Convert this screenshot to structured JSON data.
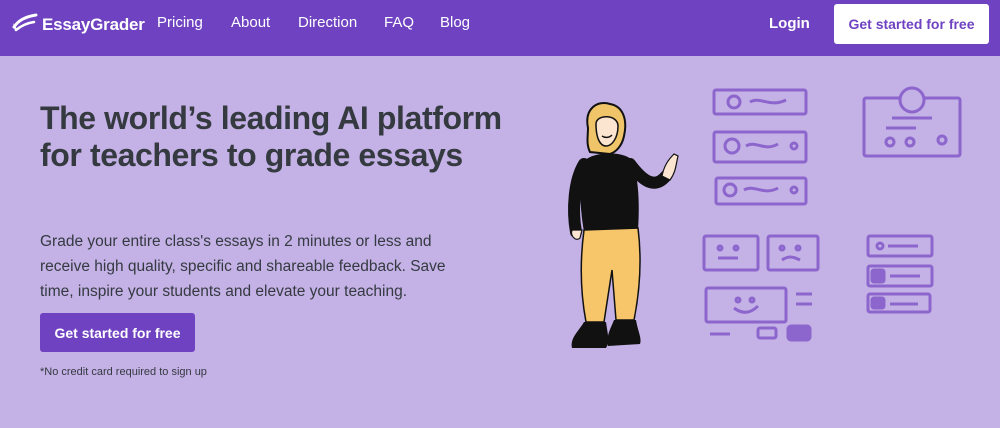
{
  "nav": {
    "brand": "EssayGrader",
    "links": [
      "Pricing",
      "About",
      "Direction",
      "FAQ",
      "Blog"
    ],
    "login": "Login",
    "cta": "Get started for free"
  },
  "hero": {
    "headline": "The world’s leading AI platform for teachers to grade essays",
    "subtext": "Grade your entire class's essays in 2 minutes or less and receive high quality, specific and shareable feedback. Save time, inspire your students and elevate your teaching.",
    "cta": "Get started for free",
    "note": "*No credit card required to sign up"
  },
  "colors": {
    "nav_bg": "#6f42c1",
    "page_bg": "#c4b1e6",
    "accent": "#6f42c1",
    "text": "#343a40"
  },
  "icons": [
    "logo-icon"
  ],
  "illustration": "woman-pointing-at-feedback-cards"
}
